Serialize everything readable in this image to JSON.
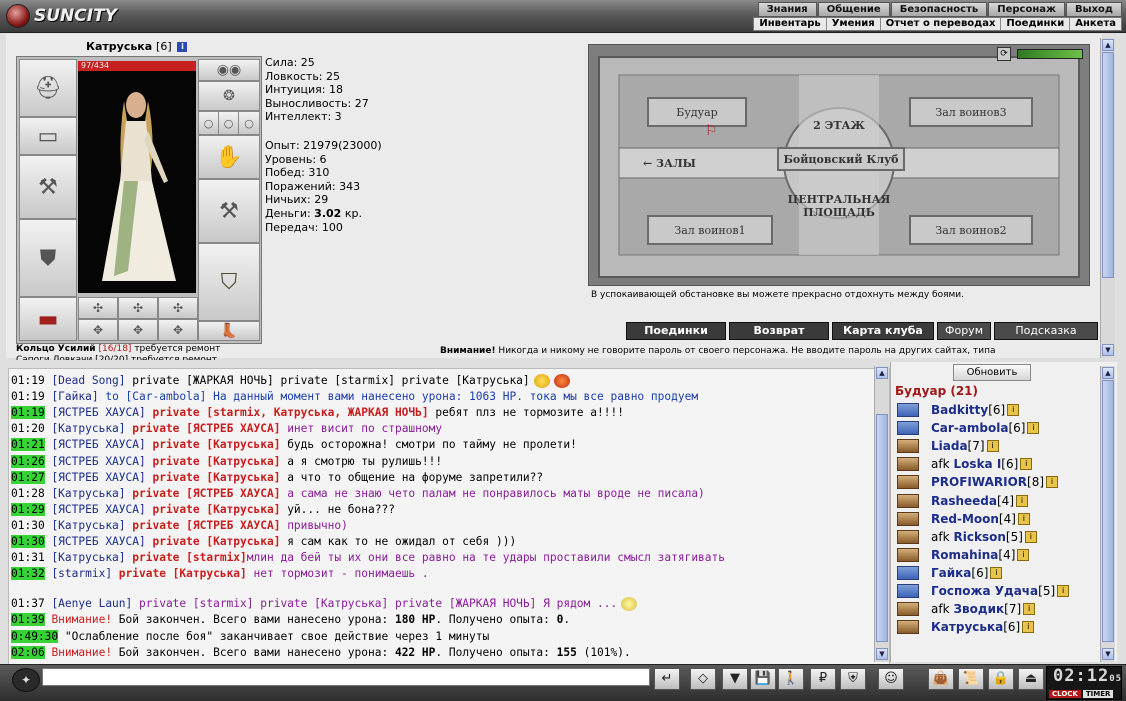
{
  "app": {
    "logo_text": "SUNCITY"
  },
  "topnav": [
    "Знания",
    "Общение",
    "Безопасность",
    "Персонаж",
    "Выход"
  ],
  "subnav": [
    "Инвентарь",
    "Умения",
    "Отчет о переводах",
    "Поединки",
    "Анкета"
  ],
  "character": {
    "name": "Катруська",
    "level": "[6]",
    "info_glyph": "i",
    "hp": "97/434",
    "hp_fraction": 0.22,
    "stats": [
      "Сила: 25",
      "Ловкость: 25",
      "Интуиция: 18",
      "Выносливость: 27",
      "Интеллект: 3"
    ],
    "stats2": [
      "Опыт: 21979(23000)",
      "Уровень: 6",
      "Побед: 310",
      "Поражений: 343",
      "Ничьих: 29"
    ],
    "money_label": "Деньги:",
    "money_value": "3.02",
    "money_unit": "кр.",
    "transfers": "Передач: 100"
  },
  "warnings": {
    "ring_name": "Кольцо Усилий",
    "ring_count": "[16/18]",
    "ring_text": "требуется ремонт",
    "second_line": "Сапоги Ловкачи [20/20] требуется ремонт"
  },
  "map": {
    "rooms": [
      "Будуар",
      "Зал воинов3",
      "Зал воинов1",
      "Зал воинов2"
    ],
    "floor_label": "2 ЭТАЖ",
    "club_label": "Бойцовский Клуб",
    "halls_label": "← ЗАЛЫ",
    "center_label": "ЦЕНТРАЛЬНАЯ ПЛОЩАДЬ",
    "caption": "В успокаивающей обстановке вы можете прекрасно отдохнуть между боями.",
    "energy_fraction": 1.0
  },
  "buttons": [
    "Поединки",
    "Возврат",
    "Карта клуба",
    "Форум",
    "Подсказка"
  ],
  "security_warning": {
    "bold": "Внимание!",
    "text": "Никогда и никому не говорите пароль от своего персонажа. Не вводите пароль на других сайтах, типа"
  },
  "chat": {
    "lines": [
      {
        "ts": "01:19",
        "hl": false,
        "parts": [
          {
            "c": "nick",
            "t": "[Dead Song]"
          },
          {
            "c": "msg-black",
            "t": " private [ЖАРКАЯ НОЧЬ] private [starmix] private [Катруська]"
          }
        ]
      },
      {
        "ts": "01:19",
        "hl": false,
        "parts": [
          {
            "c": "nick",
            "t": "[Гайка]"
          },
          {
            "c": "msg-blue",
            "t": " to [Car-ambola] На данный момент вами нанесено урона: 1063 HP. тока мы все равно продуем"
          }
        ]
      },
      {
        "ts": "01:19",
        "hl": true,
        "parts": [
          {
            "c": "nick",
            "t": "[ЯСТРЕБ ХАУСА]"
          },
          {
            "c": "priv",
            "t": " private [starmix, Катруська, ЖАРКАЯ НОЧЬ]"
          },
          {
            "c": "msg-black",
            "t": " ребят плз не тормозите а!!!!"
          }
        ]
      },
      {
        "ts": "01:20",
        "hl": false,
        "parts": [
          {
            "c": "nick",
            "t": "[Катруська]"
          },
          {
            "c": "priv",
            "t": " private [ЯСТРЕБ ХАУСА]"
          },
          {
            "c": "msg-purple",
            "t": " инет висит по страшному"
          }
        ]
      },
      {
        "ts": "01:21",
        "hl": true,
        "parts": [
          {
            "c": "nick",
            "t": "[ЯСТРЕБ ХАУСА]"
          },
          {
            "c": "priv",
            "t": " private [Катруська]"
          },
          {
            "c": "msg-black",
            "t": " будь осторожна! смотри по тайму не пролети!"
          }
        ]
      },
      {
        "ts": "01:26",
        "hl": true,
        "parts": [
          {
            "c": "nick",
            "t": "[ЯСТРЕБ ХАУСА]"
          },
          {
            "c": "priv",
            "t": " private [Катруська]"
          },
          {
            "c": "msg-black",
            "t": " а я смотрю ты рулишь!!!"
          }
        ]
      },
      {
        "ts": "01:27",
        "hl": true,
        "parts": [
          {
            "c": "nick",
            "t": "[ЯСТРЕБ ХАУСА]"
          },
          {
            "c": "priv",
            "t": " private [Катруська]"
          },
          {
            "c": "msg-black",
            "t": " а что то общение на форуме запретили??"
          }
        ]
      },
      {
        "ts": "01:28",
        "hl": false,
        "parts": [
          {
            "c": "nick",
            "t": "[Катруська]"
          },
          {
            "c": "priv",
            "t": " private [ЯСТРЕБ ХАУСА]"
          },
          {
            "c": "msg-purple",
            "t": " а сама не знаю чето палам не понравилось маты вроде не писала)"
          }
        ]
      },
      {
        "ts": "01:29",
        "hl": true,
        "parts": [
          {
            "c": "nick",
            "t": "[ЯСТРЕБ ХАУСА]"
          },
          {
            "c": "priv",
            "t": " private [Катруська]"
          },
          {
            "c": "msg-black",
            "t": " уй... не бона???"
          }
        ]
      },
      {
        "ts": "01:30",
        "hl": false,
        "parts": [
          {
            "c": "nick",
            "t": "[Катруська]"
          },
          {
            "c": "priv",
            "t": " private [ЯСТРЕБ ХАУСА]"
          },
          {
            "c": "msg-purple",
            "t": " привычно)"
          }
        ]
      },
      {
        "ts": "01:30",
        "hl": true,
        "parts": [
          {
            "c": "nick",
            "t": "[ЯСТРЕБ ХАУСА]"
          },
          {
            "c": "priv",
            "t": " private [Катруська]"
          },
          {
            "c": "msg-black",
            "t": " я сам как то не ожидал от себя )))"
          }
        ]
      },
      {
        "ts": "01:31",
        "hl": false,
        "parts": [
          {
            "c": "nick",
            "t": "[Катруська]"
          },
          {
            "c": "priv",
            "t": " private [starmix]"
          },
          {
            "c": "msg-purple",
            "t": "млин да бей ты их они все равно на те удары проставили смысл затягивать"
          }
        ]
      },
      {
        "ts": "01:32",
        "hl": true,
        "parts": [
          {
            "c": "nick",
            "t": "[starmix]"
          },
          {
            "c": "priv",
            "t": " private [Катруська]"
          },
          {
            "c": "msg-purple",
            "t": " нет тормозит - понимаешь ."
          }
        ]
      }
    ],
    "lines2": [
      {
        "ts": "01:37",
        "hl": false,
        "parts": [
          {
            "c": "nick",
            "t": "[Aenye Laun]"
          },
          {
            "c": "msg-purple",
            "t": " private [starmix] private [Катруська] private [ЖАРКАЯ НОЧЬ] Я рядом ..."
          }
        ]
      },
      {
        "ts": "01:39",
        "hl": true,
        "parts": [
          {
            "c": "warnw",
            "t": "Внимание!"
          },
          {
            "c": "msg-black",
            "t": " Бой закончен. Всего вами нанесено урона: "
          },
          {
            "c": "b",
            "t": "180 HP"
          },
          {
            "c": "msg-black",
            "t": ". Получено опыта: "
          },
          {
            "c": "b",
            "t": "0"
          },
          {
            "c": "msg-black",
            "t": "."
          }
        ]
      },
      {
        "ts": "0:49:30",
        "hl": true,
        "parts": [
          {
            "c": "msg-black",
            "t": "\"Ослабление после боя\" заканчивает свое действие через 1 минуты"
          }
        ]
      },
      {
        "ts": "02:06",
        "hl": true,
        "parts": [
          {
            "c": "warnw",
            "t": "Внимание!"
          },
          {
            "c": "msg-black",
            "t": " Бой закончен. Всего вами нанесено урона: "
          },
          {
            "c": "b",
            "t": "422 HP"
          },
          {
            "c": "msg-black",
            "t": ". Получено опыта: "
          },
          {
            "c": "b",
            "t": "155"
          },
          {
            "c": "msg-black",
            "t": " (101%)."
          }
        ]
      }
    ]
  },
  "online": {
    "refresh": "Обновить",
    "title": "Будуар (21)",
    "users": [
      {
        "name": "Badkitty",
        "lvl": "[6]",
        "afk": "",
        "icon": "battle"
      },
      {
        "name": "Car-ambola",
        "lvl": "[6]",
        "afk": "",
        "icon": "battle"
      },
      {
        "name": "Liada",
        "lvl": "[7]",
        "afk": "",
        "icon": "duel"
      },
      {
        "name": "Loska I",
        "lvl": "[6]",
        "afk": "afk",
        "icon": "duel"
      },
      {
        "name": "PROFIWARIOR",
        "lvl": "[8]",
        "afk": "",
        "icon": "duel"
      },
      {
        "name": "Rasheeda",
        "lvl": "[4]",
        "afk": "",
        "icon": "duel"
      },
      {
        "name": "Red-Moon",
        "lvl": "[4]",
        "afk": "",
        "icon": "duel"
      },
      {
        "name": "Rickson",
        "lvl": "[5]",
        "afk": "afk",
        "icon": "duel"
      },
      {
        "name": "Romahina",
        "lvl": "[4]",
        "afk": "",
        "icon": "duel"
      },
      {
        "name": "Гайка",
        "lvl": "[6]",
        "afk": "",
        "icon": "battle"
      },
      {
        "name": "Госпожа Удача",
        "lvl": "[5]",
        "afk": "",
        "icon": "battle"
      },
      {
        "name": "Зводик",
        "lvl": "[7]",
        "afk": "afk",
        "icon": "duel"
      },
      {
        "name": "Катруська",
        "lvl": "[6]",
        "afk": "",
        "icon": "duel"
      }
    ]
  },
  "bottom": {
    "input_value": "",
    "clock_time": "02:12",
    "clock_seconds": "05",
    "clock_label": "CLOCK",
    "timer_label": "TIMER",
    "icons": [
      "send-icon",
      "eraser-icon",
      "filter-icon",
      "save-icon",
      "walk-icon",
      "translit-icon",
      "shield-icon",
      "smiley-icon",
      "bag-icon",
      "scroll-icon",
      "lock-icon",
      "exit-icon"
    ]
  },
  "colors": {
    "accent_red": "#c81e1e",
    "nick_blue": "#1c2d8a",
    "timestamp_green": "#36d236"
  }
}
